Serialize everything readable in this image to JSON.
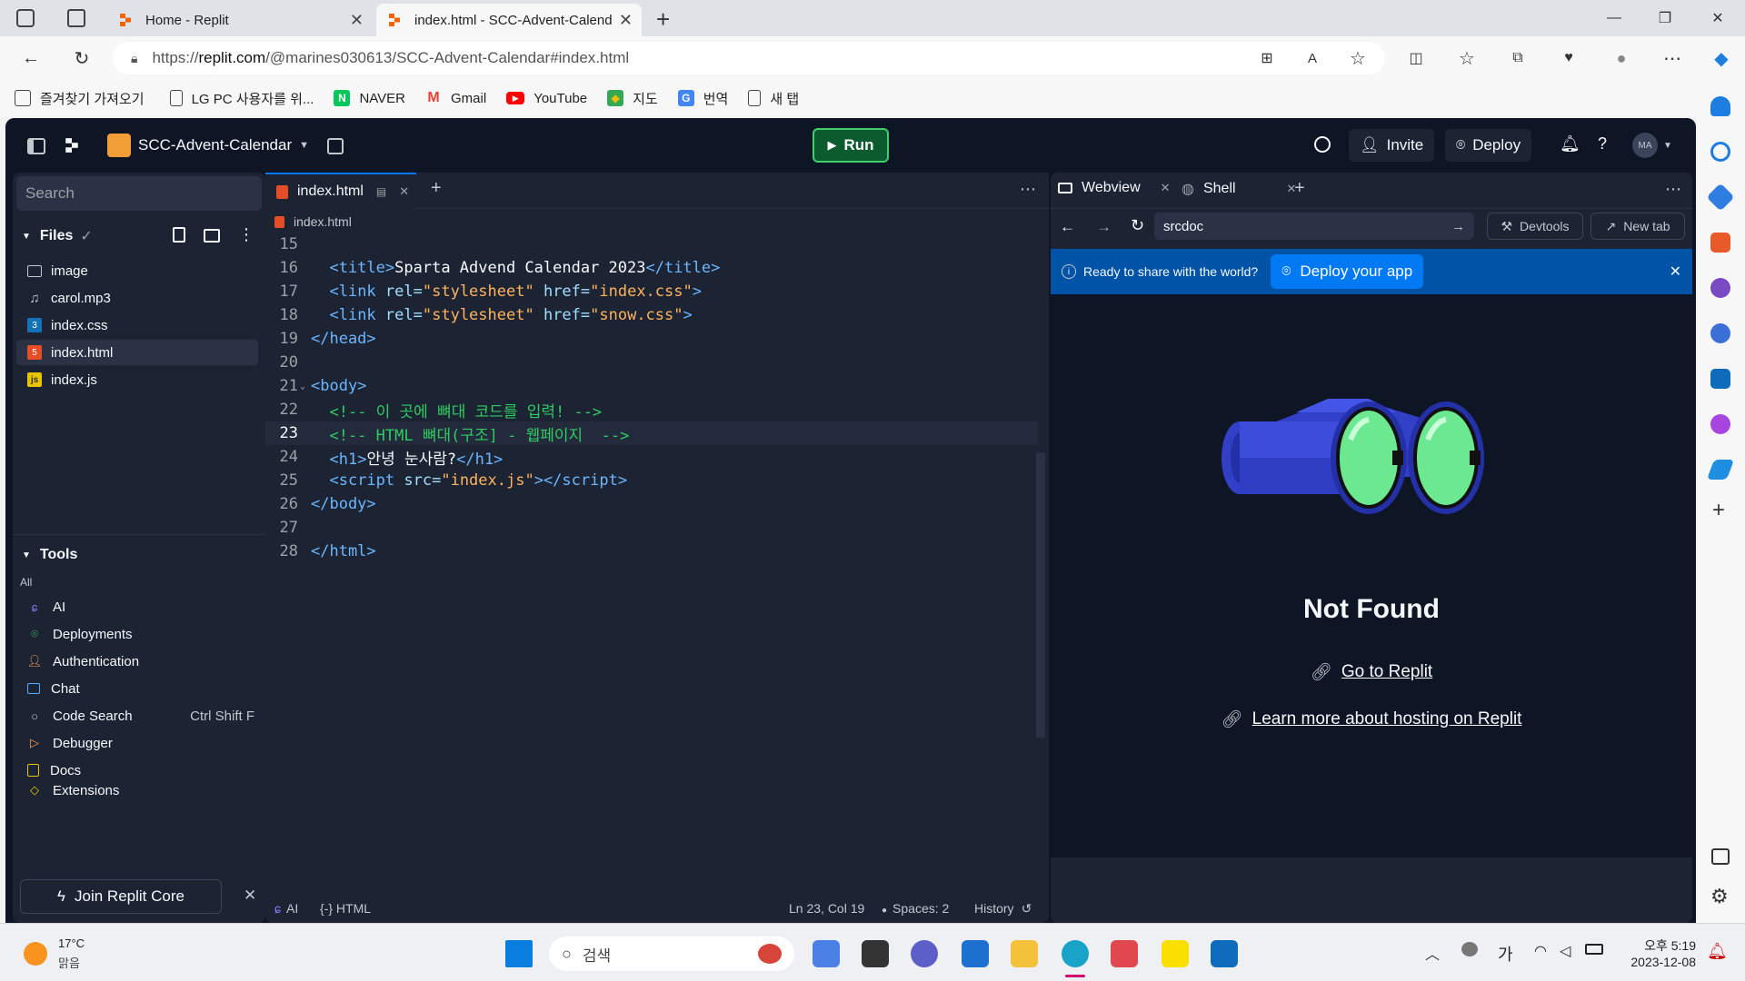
{
  "browser": {
    "tabs": [
      {
        "title": "Home - Replit",
        "active": false
      },
      {
        "title": "index.html - SCC-Advent-Calend",
        "active": true
      }
    ],
    "url_scheme": "https://",
    "url_host": "replit.com",
    "url_path": "/@marines030613/SCC-Advent-Calendar#index.html",
    "bookmarks": [
      {
        "label": "즐겨찾기 가져오기",
        "icon": "import-icon"
      },
      {
        "label": "LG PC 사용자를 위...",
        "icon": "page-icon"
      },
      {
        "label": "NAVER",
        "icon": "naver-icon"
      },
      {
        "label": "Gmail",
        "icon": "gmail-icon"
      },
      {
        "label": "YouTube",
        "icon": "youtube-icon"
      },
      {
        "label": "지도",
        "icon": "map-icon"
      },
      {
        "label": "번역",
        "icon": "translate-icon"
      },
      {
        "label": "새 탭",
        "icon": "page-icon"
      }
    ]
  },
  "replit": {
    "repl_name": "SCC-Advent-Calendar",
    "run_label": "Run",
    "invite_label": "Invite",
    "deploy_label": "Deploy",
    "avatar_initials": "MA",
    "sidebar": {
      "search_placeholder": "Search",
      "files_header": "Files",
      "files": [
        {
          "name": "image",
          "type": "folder"
        },
        {
          "name": "carol.mp3",
          "type": "audio"
        },
        {
          "name": "index.css",
          "type": "css"
        },
        {
          "name": "index.html",
          "type": "html",
          "selected": true
        },
        {
          "name": "index.js",
          "type": "js"
        }
      ],
      "tools_header": "Tools",
      "tools_filter": "All",
      "tools": [
        {
          "name": "AI",
          "shortcut": ""
        },
        {
          "name": "Deployments",
          "shortcut": ""
        },
        {
          "name": "Authentication",
          "shortcut": ""
        },
        {
          "name": "Chat",
          "shortcut": ""
        },
        {
          "name": "Code Search",
          "shortcut": "Ctrl Shift F"
        },
        {
          "name": "Debugger",
          "shortcut": ""
        },
        {
          "name": "Docs",
          "shortcut": ""
        },
        {
          "name": "Extensions",
          "shortcut": ""
        }
      ],
      "join_core_label": "Join Replit Core"
    },
    "editor": {
      "tab_name": "index.html",
      "breadcrumb": "index.html",
      "status": {
        "ai": "AI",
        "lang": "{-} HTML",
        "position": "Ln 23, Col 19",
        "spaces": "Spaces: 2",
        "history": "History"
      }
    },
    "webview": {
      "tab_webview": "Webview",
      "tab_shell": "Shell",
      "address": "srcdoc",
      "devtools_label": "Devtools",
      "newtab_label": "New tab",
      "banner_text": "Ready to share with the world?",
      "deploy_app_label": "Deploy your app",
      "not_found_title": "Not Found",
      "link_replit": "Go to Replit",
      "link_hosting": "Learn more about hosting on Replit"
    }
  },
  "taskbar": {
    "weather_temp": "17°C",
    "weather_desc": "맑음",
    "search_placeholder": "검색",
    "ime": "가",
    "time": "오후 5:19",
    "date": "2023-12-08"
  },
  "colors": {
    "replit_bg": "#0e1525",
    "panel_bg": "#1c2333",
    "run_green": "#0b5b2e",
    "deploy_blue": "#0079f2",
    "binocular_blue": "#3d4ddb",
    "lens_green": "#6ce890"
  }
}
